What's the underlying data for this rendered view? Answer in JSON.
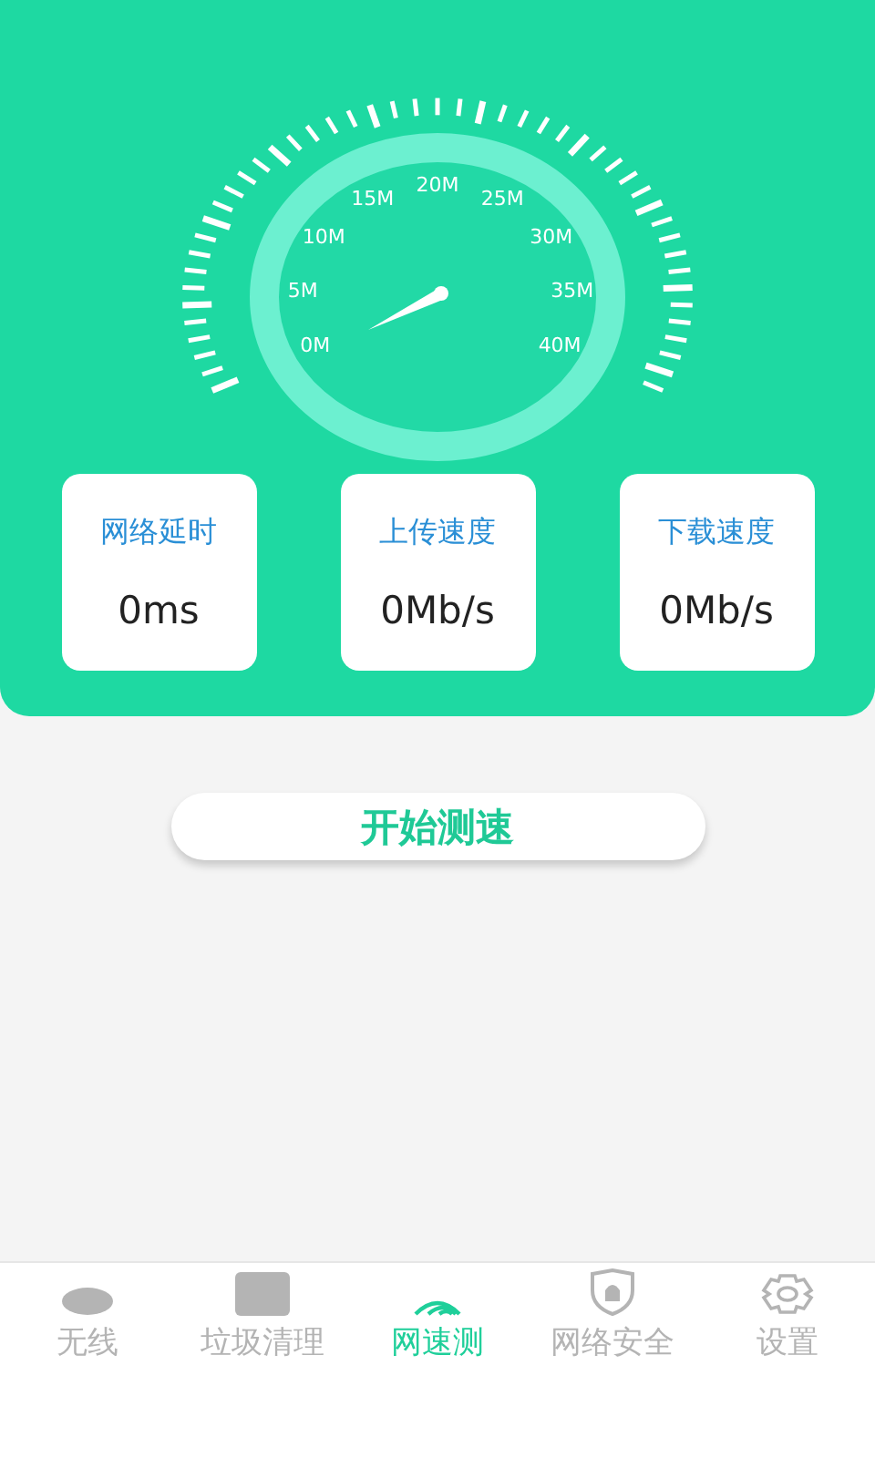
{
  "gauge": {
    "labels": [
      "0M",
      "5M",
      "10M",
      "15M",
      "20M",
      "25M",
      "30M",
      "35M",
      "40M"
    ]
  },
  "stats": [
    {
      "label": "网络延时",
      "value": "0ms"
    },
    {
      "label": "上传速度",
      "value": "0Mb/s"
    },
    {
      "label": "下载速度",
      "value": "0Mb/s"
    }
  ],
  "start_button": "开始测速",
  "tabs": [
    {
      "kind": "oval",
      "label": "无线",
      "selected": false
    },
    {
      "kind": "square",
      "label": "垃圾清理",
      "selected": false
    },
    {
      "kind": "wifi",
      "label": "网速测",
      "selected": true
    },
    {
      "kind": "shield",
      "label": "网络安全",
      "selected": false
    },
    {
      "kind": "gear",
      "label": "设置",
      "selected": false
    }
  ]
}
